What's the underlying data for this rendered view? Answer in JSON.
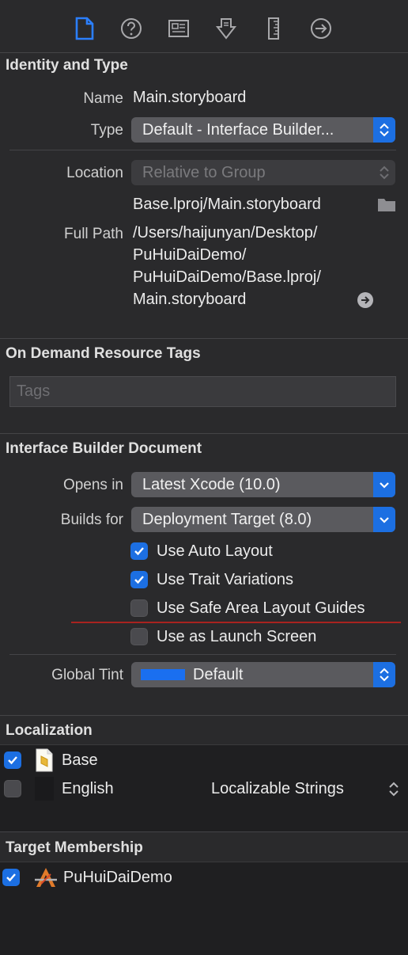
{
  "toolbar": {
    "icons": [
      "file-inspector-icon",
      "quick-help-icon",
      "identity-inspector-icon",
      "attributes-inspector-icon",
      "size-inspector-icon",
      "connections-inspector-icon"
    ]
  },
  "identity": {
    "title": "Identity and Type",
    "name_label": "Name",
    "name_value": "Main.storyboard",
    "type_label": "Type",
    "type_value": "Default - Interface Builder...",
    "location_label": "Location",
    "location_value": "Relative to Group",
    "location_path": "Base.lproj/Main.storyboard",
    "fullpath_label": "Full Path",
    "fullpath_lines": [
      "/Users/haijunyan/Desktop/",
      "PuHuiDaiDemo/",
      "PuHuiDaiDemo/Base.lproj/",
      "Main.storyboard"
    ]
  },
  "tags": {
    "title": "On Demand Resource Tags",
    "placeholder": "Tags"
  },
  "ib": {
    "title": "Interface Builder Document",
    "opens_label": "Opens in",
    "opens_value": "Latest Xcode (10.0)",
    "builds_label": "Builds for",
    "builds_value": "Deployment Target (8.0)",
    "options": [
      {
        "label": "Use Auto Layout",
        "checked": true
      },
      {
        "label": "Use Trait Variations",
        "checked": true
      },
      {
        "label": "Use Safe Area Layout Guides",
        "checked": false
      },
      {
        "label": "Use as Launch Screen",
        "checked": false
      }
    ],
    "tint_label": "Global Tint",
    "tint_value": "Default",
    "tint_color": "#1a6ff0"
  },
  "localization": {
    "title": "Localization",
    "rows": [
      {
        "label": "Base",
        "checked": true,
        "type": ""
      },
      {
        "label": "English",
        "checked": false,
        "type": "Localizable Strings"
      }
    ]
  },
  "target": {
    "title": "Target Membership",
    "items": [
      {
        "label": "PuHuiDaiDemo",
        "checked": true
      }
    ]
  },
  "colors": {
    "accent": "#1c6fe2",
    "background": "#2a2a2c",
    "separator_red": "#a8231f"
  }
}
